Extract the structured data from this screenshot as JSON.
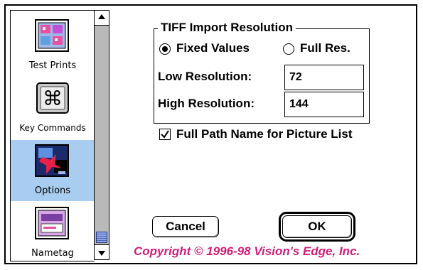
{
  "sidebar": {
    "items": [
      {
        "label": "Test Prints",
        "icon": "test-prints-icon",
        "selected": false
      },
      {
        "label": "Key Commands",
        "icon": "command-key-icon",
        "selected": false
      },
      {
        "label": "Options",
        "icon": "options-icon",
        "selected": true
      },
      {
        "label": "Nametag",
        "icon": "nametag-icon",
        "selected": false
      }
    ],
    "selected_color": "#a9cdf0"
  },
  "tiff_group": {
    "title": "TIFF Import Resolution",
    "radio_fixed_label": "Fixed Values",
    "radio_fixed_selected": true,
    "radio_full_label": "Full Res.",
    "radio_full_selected": false,
    "low_label": "Low Resolution:",
    "low_value": "72",
    "high_label": "High Resolution:",
    "high_value": "144"
  },
  "full_path_checkbox": {
    "label": "Full Path Name for Picture List",
    "checked": true
  },
  "buttons": {
    "cancel_label": "Cancel",
    "ok_label": "OK"
  },
  "copyright": {
    "text": "Copyright © 1996-98 Vision's Edge, Inc.",
    "color": "#d01f77"
  }
}
